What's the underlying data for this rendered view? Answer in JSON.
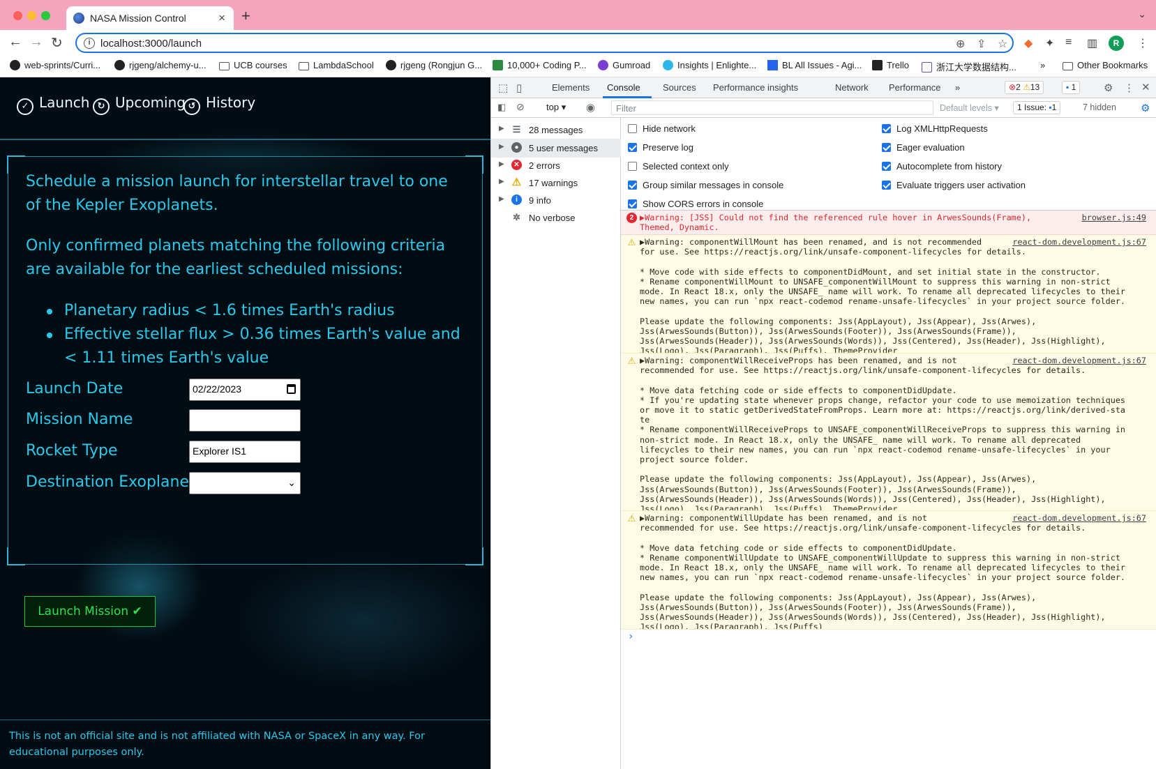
{
  "browser": {
    "tab_title": "NASA Mission Control",
    "url": "localhost:3000/launch",
    "bookmarks": [
      "web-sprints/Curri...",
      "rjgeng/alchemy-u...",
      "UCB courses",
      "LambdaSchool",
      "rjgeng (Rongjun G...",
      "10,000+ Coding P...",
      "Gumroad",
      "Insights | Enlighte...",
      "BL All Issues - Agi...",
      "Trello",
      "浙江大学数据结构..."
    ],
    "other_bookmarks": "Other Bookmarks",
    "overflow": "»",
    "profile_initial": "R"
  },
  "app": {
    "nav": [
      "Launch",
      "Upcoming",
      "History"
    ],
    "intro1": "Schedule a mission launch for interstellar travel to one of the Kepler Exoplanets.",
    "intro2": "Only confirmed planets matching the following criteria are available for the earliest scheduled missions:",
    "criteria": [
      "Planetary radius < 1.6 times Earth's radius",
      "Effective stellar flux > 0.36 times Earth's value and < 1.11 times Earth's value"
    ],
    "form": {
      "launch_date_label": "Launch Date",
      "launch_date_value": "02/22/2023",
      "mission_name_label": "Mission Name",
      "mission_name_value": "",
      "rocket_type_label": "Rocket Type",
      "rocket_type_value": "Explorer IS1",
      "destination_label": "Destination Exoplanet",
      "destination_value": ""
    },
    "launch_button": "Launch Mission ✔",
    "footer": "This is not an official site and is not affiliated with NASA or SpaceX in any way. For educational purposes only."
  },
  "devtools": {
    "tabs": [
      "Elements",
      "Console",
      "Sources",
      "Performance insights",
      "Network",
      "Performance"
    ],
    "active_tab": "Console",
    "more_tabs": "»",
    "badges": {
      "errors": "2",
      "warnings": "13",
      "issues_msgs": "1"
    },
    "context": "top",
    "filter_placeholder": "Filter",
    "levels": "Default levels",
    "issues": "1 Issue:",
    "issues_count": "1",
    "hidden": "7 hidden",
    "sidebar": [
      {
        "label": "28 messages",
        "icon": "list-icon"
      },
      {
        "label": "5 user messages",
        "icon": "user-icon"
      },
      {
        "label": "2 errors",
        "icon": "error-icon"
      },
      {
        "label": "17 warnings",
        "icon": "warning-icon"
      },
      {
        "label": "9 info",
        "icon": "info-icon"
      },
      {
        "label": "No verbose",
        "icon": "bug-icon"
      }
    ],
    "settings_left": [
      "Hide network",
      "Preserve log",
      "Selected context only",
      "Group similar messages in console",
      "Show CORS errors in console"
    ],
    "settings_right": [
      "Log XMLHttpRequests",
      "Eager evaluation",
      "Autocomplete from history",
      "Evaluate triggers user activation"
    ],
    "messages": [
      {
        "level": "error",
        "count": "2",
        "text": "▶Warning: [JSS] Could not find the referenced rule hover in ArwesSounds(Frame),\nThemed, Dynamic.",
        "source": "browser.js:49"
      },
      {
        "level": "warning",
        "text": "▶Warning: componentWillMount has been renamed, and is not recommended\nfor use. See https://reactjs.org/link/unsafe-component-lifecycles for details.\n\n* Move code with side effects to componentDidMount, and set initial state in the constructor.\n* Rename componentWillMount to UNSAFE_componentWillMount to suppress this warning in non-strict\nmode. In React 18.x, only the UNSAFE_ name will work. To rename all deprecated lifecycles to their\nnew names, you can run `npx react-codemod rename-unsafe-lifecycles` in your project source folder.\n\nPlease update the following components: Jss(AppLayout), Jss(Appear), Jss(Arwes),\nJss(ArwesSounds(Button)), Jss(ArwesSounds(Footer)), Jss(ArwesSounds(Frame)),\nJss(ArwesSounds(Header)), Jss(ArwesSounds(Words)), Jss(Centered), Jss(Header), Jss(Highlight),\nJss(Logo), Jss(Paragraph), Jss(Puffs), ThemeProvider",
        "source": "react-dom.development.js:67"
      },
      {
        "level": "warning",
        "text": "▶Warning: componentWillReceiveProps has been renamed, and is not\nrecommended for use. See https://reactjs.org/link/unsafe-component-lifecycles for details.\n\n* Move data fetching code or side effects to componentDidUpdate.\n* If you're updating state whenever props change, refactor your code to use memoization techniques\nor move it to static getDerivedStateFromProps. Learn more at: https://reactjs.org/link/derived-sta\nte\n* Rename componentWillReceiveProps to UNSAFE_componentWillReceiveProps to suppress this warning in\nnon-strict mode. In React 18.x, only the UNSAFE_ name will work. To rename all deprecated\nlifecycles to their new names, you can run `npx react-codemod rename-unsafe-lifecycles` in your\nproject source folder.\n\nPlease update the following components: Jss(AppLayout), Jss(Appear), Jss(Arwes),\nJss(ArwesSounds(Button)), Jss(ArwesSounds(Footer)), Jss(ArwesSounds(Frame)),\nJss(ArwesSounds(Header)), Jss(ArwesSounds(Words)), Jss(Centered), Jss(Header), Jss(Highlight),\nJss(Logo), Jss(Paragraph), Jss(Puffs), ThemeProvider",
        "source": "react-dom.development.js:67"
      },
      {
        "level": "warning",
        "text": "▶Warning: componentWillUpdate has been renamed, and is not\nrecommended for use. See https://reactjs.org/link/unsafe-component-lifecycles for details.\n\n* Move data fetching code or side effects to componentDidUpdate.\n* Rename componentWillUpdate to UNSAFE_componentWillUpdate to suppress this warning in non-strict\nmode. In React 18.x, only the UNSAFE_ name will work. To rename all deprecated lifecycles to their\nnew names, you can run `npx react-codemod rename-unsafe-lifecycles` in your project source folder.\n\nPlease update the following components: Jss(AppLayout), Jss(Appear), Jss(Arwes),\nJss(ArwesSounds(Button)), Jss(ArwesSounds(Footer)), Jss(ArwesSounds(Frame)),\nJss(ArwesSounds(Header)), Jss(ArwesSounds(Words)), Jss(Centered), Jss(Header), Jss(Highlight),\nJss(Logo), Jss(Paragraph), Jss(Puffs)",
        "source": "react-dom.development.js:67"
      }
    ],
    "prompt": "›"
  }
}
